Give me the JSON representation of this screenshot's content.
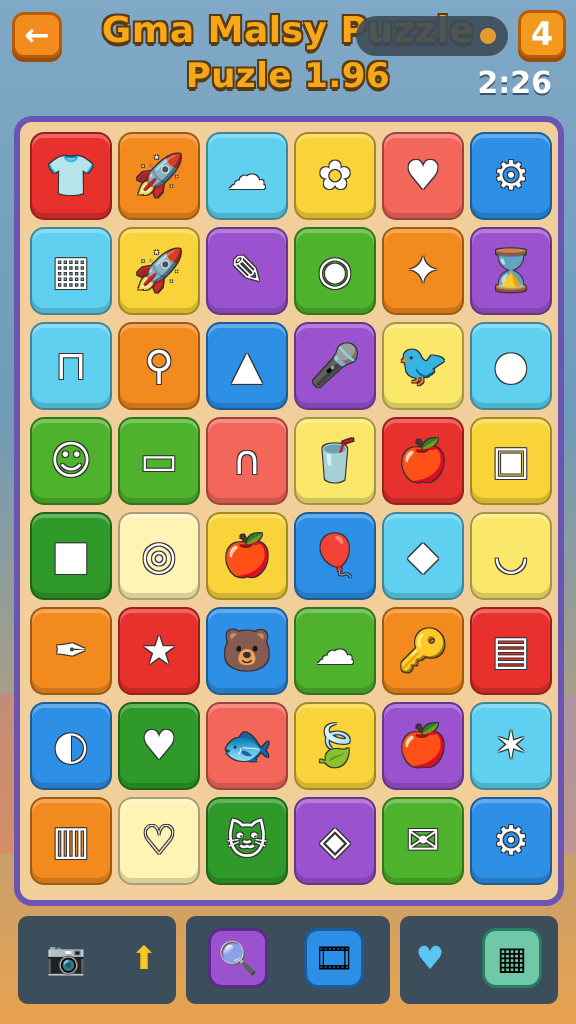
{
  "header": {
    "back_icon": "←",
    "title_line1": "Gma Malsy Puzzle",
    "title_line2": "Puzle 1.96",
    "level": "4",
    "timer": "2:26"
  },
  "board": {
    "rows": [
      [
        {
          "name": "shirt",
          "color": "c-red",
          "icon": "👕"
        },
        {
          "name": "rocket",
          "color": "c-orange",
          "icon": "🚀"
        },
        {
          "name": "cloud",
          "color": "c-lblue",
          "icon": "☁"
        },
        {
          "name": "flower",
          "color": "c-yellow",
          "icon": "✿"
        },
        {
          "name": "heart-face",
          "color": "c-salmon",
          "icon": "♥"
        },
        {
          "name": "gear",
          "color": "c-blue",
          "icon": "⚙"
        }
      ],
      [
        {
          "name": "calculator",
          "color": "c-lblue",
          "icon": "▦"
        },
        {
          "name": "rocket",
          "color": "c-yellow",
          "icon": "🚀"
        },
        {
          "name": "pencil",
          "color": "c-purple",
          "icon": "✎"
        },
        {
          "name": "plate",
          "color": "c-green",
          "icon": "◉"
        },
        {
          "name": "compass",
          "color": "c-orange",
          "icon": "✦"
        },
        {
          "name": "hourglass",
          "color": "c-purple",
          "icon": "⌛"
        }
      ],
      [
        {
          "name": "table",
          "color": "c-lblue",
          "icon": "⊓"
        },
        {
          "name": "paint-roller",
          "color": "c-orange",
          "icon": "⚲"
        },
        {
          "name": "triangle",
          "color": "c-blue",
          "icon": "▲"
        },
        {
          "name": "microphone",
          "color": "c-purple",
          "icon": "🎤"
        },
        {
          "name": "bird",
          "color": "c-lyellow",
          "icon": "🐦"
        },
        {
          "name": "ball",
          "color": "c-lblue",
          "icon": "●"
        }
      ],
      [
        {
          "name": "smiley-face",
          "color": "c-green",
          "icon": "☺"
        },
        {
          "name": "box",
          "color": "c-green",
          "icon": "▭"
        },
        {
          "name": "arch",
          "color": "c-salmon",
          "icon": "∩"
        },
        {
          "name": "cup",
          "color": "c-lyellow",
          "icon": "🥤"
        },
        {
          "name": "apple",
          "color": "c-red",
          "icon": "🍎"
        },
        {
          "name": "id-card",
          "color": "c-yellow",
          "icon": "▣"
        }
      ],
      [
        {
          "name": "crate",
          "color": "c-dgreen",
          "icon": "■"
        },
        {
          "name": "ring",
          "color": "c-cream",
          "icon": "◎"
        },
        {
          "name": "apple",
          "color": "c-yellow",
          "icon": "🍎"
        },
        {
          "name": "balloon",
          "color": "c-blue",
          "icon": "🎈"
        },
        {
          "name": "kite",
          "color": "c-lblue",
          "icon": "◆"
        },
        {
          "name": "basket",
          "color": "c-lyellow",
          "icon": "◡"
        }
      ],
      [
        {
          "name": "pen",
          "color": "c-orange",
          "icon": "✒"
        },
        {
          "name": "star",
          "color": "c-red",
          "icon": "★"
        },
        {
          "name": "bear",
          "color": "c-blue",
          "icon": "🐻"
        },
        {
          "name": "cloud",
          "color": "c-green",
          "icon": "☁"
        },
        {
          "name": "key",
          "color": "c-orange",
          "icon": "🔑"
        },
        {
          "name": "phone",
          "color": "c-red",
          "icon": "▤"
        }
      ],
      [
        {
          "name": "lemon",
          "color": "c-blue",
          "icon": "◐"
        },
        {
          "name": "heart",
          "color": "c-dgreen",
          "icon": "♥"
        },
        {
          "name": "fish",
          "color": "c-salmon",
          "icon": "🐟"
        },
        {
          "name": "leaf",
          "color": "c-yellow",
          "icon": "🍃"
        },
        {
          "name": "apple",
          "color": "c-purple",
          "icon": "🍎"
        },
        {
          "name": "starfish",
          "color": "c-lblue",
          "icon": "✶"
        }
      ],
      [
        {
          "name": "chart",
          "color": "c-orange",
          "icon": "▥"
        },
        {
          "name": "heart-bowl",
          "color": "c-cream",
          "icon": "♡"
        },
        {
          "name": "cat-face",
          "color": "c-dgreen",
          "icon": "🐱"
        },
        {
          "name": "diamond",
          "color": "c-purple",
          "icon": "◈"
        },
        {
          "name": "envelope",
          "color": "c-green",
          "icon": "✉"
        },
        {
          "name": "gear",
          "color": "c-blue",
          "icon": "⚙"
        }
      ]
    ]
  },
  "toolbar": {
    "camera_icon": "📷",
    "arrow_icon": "⬆",
    "search_icon": "🔍",
    "film_icon": "🎞",
    "heart_icon": "♥",
    "keypad_icon": "▦"
  }
}
